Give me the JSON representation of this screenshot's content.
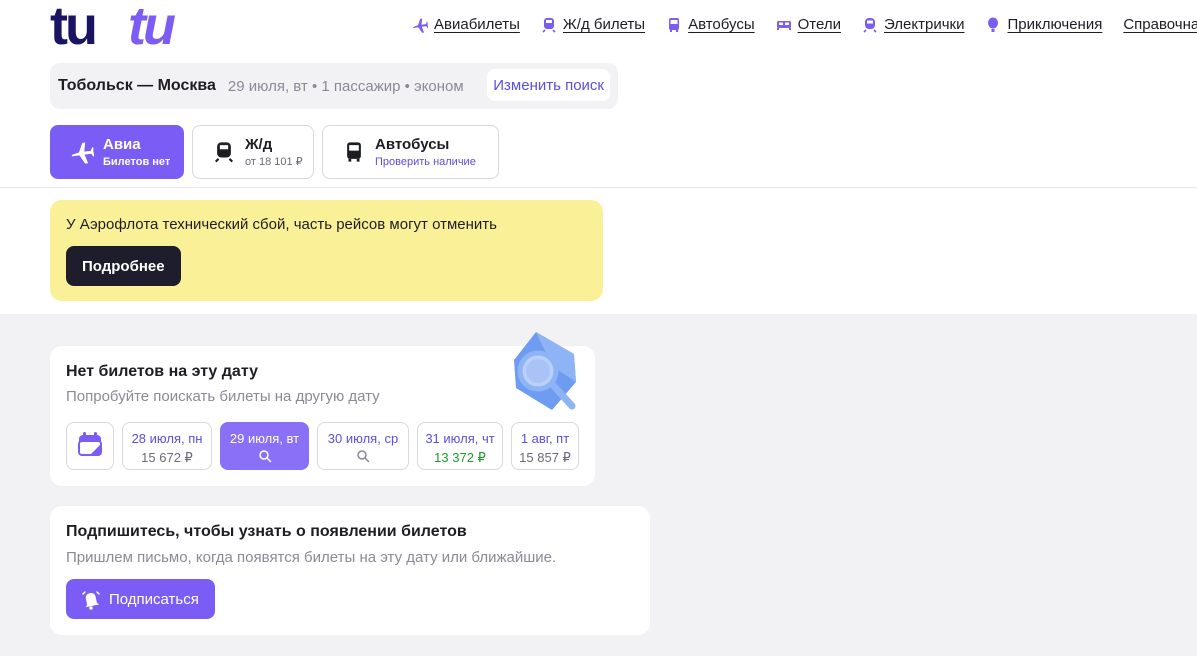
{
  "logo": {
    "text": "tutu"
  },
  "nav": [
    {
      "label": "Авиабилеты",
      "icon": "plane-icon"
    },
    {
      "label": "Ж/д билеты",
      "icon": "train-icon"
    },
    {
      "label": "Автобусы",
      "icon": "bus-icon"
    },
    {
      "label": "Отели",
      "icon": "bed-icon"
    },
    {
      "label": "Электрички",
      "icon": "commuter-train-icon"
    },
    {
      "label": "Приключения",
      "icon": "balloon-icon"
    },
    {
      "label": "Справочная",
      "icon": ""
    }
  ],
  "search": {
    "route": "Тобольск — Москва",
    "details": "29 июля, вт • 1 пассажир • эконом",
    "change_label": "Изменить поиск"
  },
  "tabs": [
    {
      "title": "Авиа",
      "subtitle": "Билетов нет",
      "icon": "plane-icon",
      "active": true
    },
    {
      "title": "Ж/д",
      "subtitle": "от 18 101 ₽",
      "icon": "train-icon",
      "active": false
    },
    {
      "title": "Автобусы",
      "subtitle": "Проверить наличие",
      "icon": "bus-icon",
      "active": false
    }
  ],
  "alert": {
    "text": "У Аэрофлота технический сбой, часть рейсов могут отменить",
    "button": "Подробнее"
  },
  "no_tickets": {
    "title": "Нет билетов на эту дату",
    "subtitle": "Попробуйте поискать билеты на другую дату",
    "dates": [
      {
        "label": "28 июля, пн",
        "price": "15 672 ₽",
        "selected": false,
        "cheapest": false
      },
      {
        "label": "29 июля, вт",
        "price": "",
        "selected": true,
        "cheapest": false
      },
      {
        "label": "30 июля, ср",
        "price": "",
        "selected": false,
        "cheapest": false
      },
      {
        "label": "31 июля, чт",
        "price": "13 372 ₽",
        "selected": false,
        "cheapest": true
      },
      {
        "label": "1 авг, пт",
        "price": "15 857 ₽",
        "selected": false,
        "cheapest": false
      }
    ]
  },
  "subscribe": {
    "title": "Подпишитесь, чтобы узнать о появлении билетов",
    "subtitle": "Пришлем письмо, когда появятся билеты на эту дату или ближайшие.",
    "button": "Подписаться"
  },
  "colors": {
    "accent": "#7b5cf5",
    "logo": "#1b1464",
    "logo_accent": "#7b5cf5",
    "alert_bg": "#faf097",
    "cheap_price": "#1f9a2b"
  }
}
